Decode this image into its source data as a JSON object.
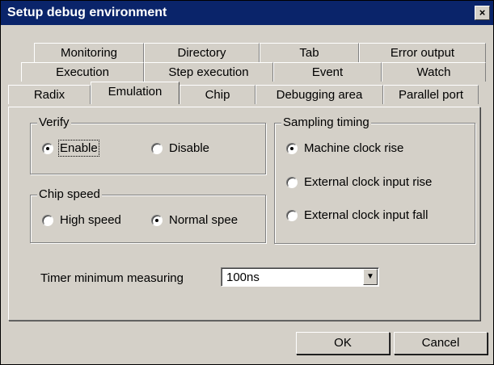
{
  "window": {
    "title": "Setup debug environment",
    "close_glyph": "×"
  },
  "tabs": {
    "row1": [
      "Monitoring",
      "Directory",
      "Tab",
      "Error output"
    ],
    "row2": [
      "Execution",
      "Step execution",
      "Event",
      "Watch"
    ],
    "row3": [
      "Radix",
      "Emulation",
      "Chip",
      "Debugging area",
      "Parallel port"
    ],
    "active": "Emulation"
  },
  "verify": {
    "title": "Verify",
    "options": [
      "Enable",
      "Disable"
    ],
    "selected": "Enable"
  },
  "chip_speed": {
    "title": "Chip speed",
    "options": [
      "High speed",
      "Normal spee"
    ],
    "selected": "Normal spee"
  },
  "sampling": {
    "title": "Sampling timing",
    "options": [
      "Machine clock rise",
      "External clock input rise",
      "External clock input fall"
    ],
    "selected": "Machine clock rise"
  },
  "timer": {
    "label": "Timer minimum measuring",
    "value": "100ns"
  },
  "buttons": {
    "ok": "OK",
    "cancel": "Cancel"
  }
}
